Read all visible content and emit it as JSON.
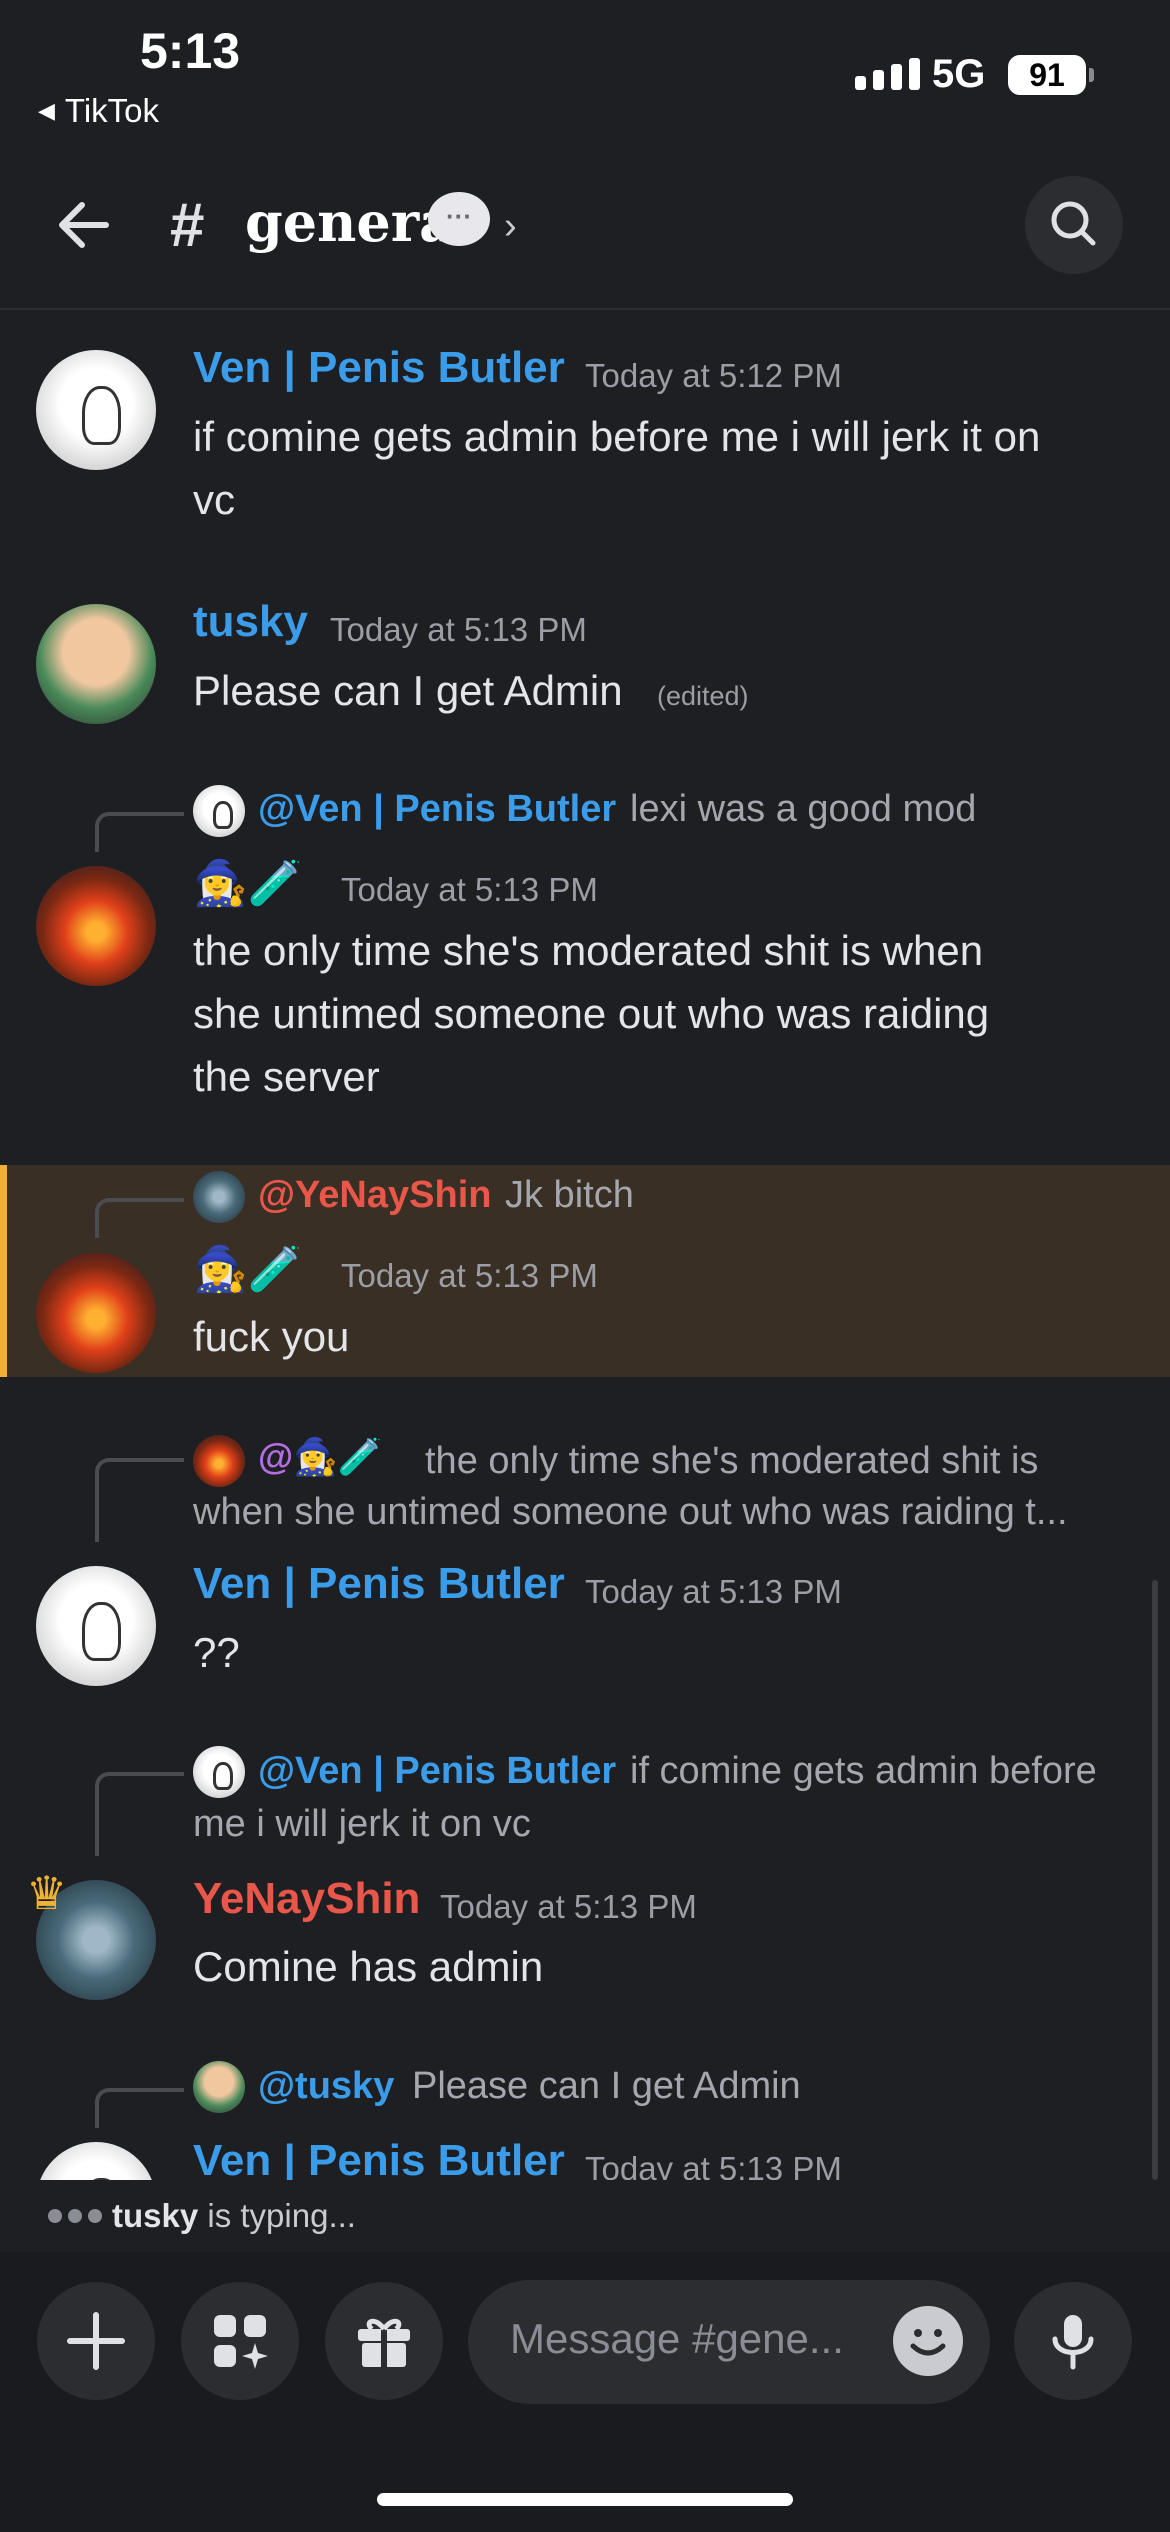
{
  "status_bar": {
    "time": "5:13",
    "back_app": "TikTok",
    "network": "5G",
    "battery": "91"
  },
  "header": {
    "channel_name": "general",
    "bubble_glyph": "···",
    "chevron": "›"
  },
  "messages": [
    {
      "author": "Ven | Penis Butler",
      "time": "Today at 5:12 PM",
      "lines": [
        "if comine gets admin before me i will jerk it on",
        "vc"
      ]
    },
    {
      "author": "tusky",
      "time": "Today at 5:13 PM",
      "lines": [
        "Please can I get Admin"
      ],
      "edited": "(edited)"
    },
    {
      "reply_name": "@Ven | Penis Butler",
      "reply_text": "lexi was a good mod",
      "author_emoji": "🧙‍♀️🧪",
      "time": "Today at 5:13 PM",
      "lines": [
        "the only time she's moderated shit is when",
        "she untimed someone out who was raiding",
        "the server"
      ]
    },
    {
      "reply_name": "@YeNayShin",
      "reply_text": "Jk bitch",
      "author_emoji": "🧙‍♀️🧪",
      "time": "Today at 5:13 PM",
      "lines": [
        "fuck you"
      ]
    },
    {
      "reply_name": "@🧙‍♀️🧪",
      "reply_text_line1": "the only time she's moderated shit is",
      "reply_text_line2": "when she untimed someone out who was raiding t...",
      "author": "Ven | Penis Butler",
      "time": "Today at 5:13 PM",
      "lines": [
        "??"
      ]
    },
    {
      "reply_name": "@Ven | Penis Butler",
      "reply_text_line1": "if comine gets admin before",
      "reply_text_line2": "me i will jerk it on vc",
      "author": "YeNayShin",
      "time": "Today at 5:13 PM",
      "lines": [
        "Comine has admin"
      ]
    },
    {
      "reply_name": "@tusky",
      "reply_text": "Please can I get Admin",
      "author": "Ven | Penis Butler",
      "time": "Today at 5:13 PM"
    }
  ],
  "typing": {
    "user": "tusky",
    "suffix": " is typing..."
  },
  "composer": {
    "placeholder": "Message #gene..."
  },
  "colors": {
    "background": "#1e1f23",
    "name_blue": "#3b9dea",
    "name_red": "#e8574a",
    "highlight": "#3a2f24",
    "highlight_bar": "#f0b232"
  }
}
